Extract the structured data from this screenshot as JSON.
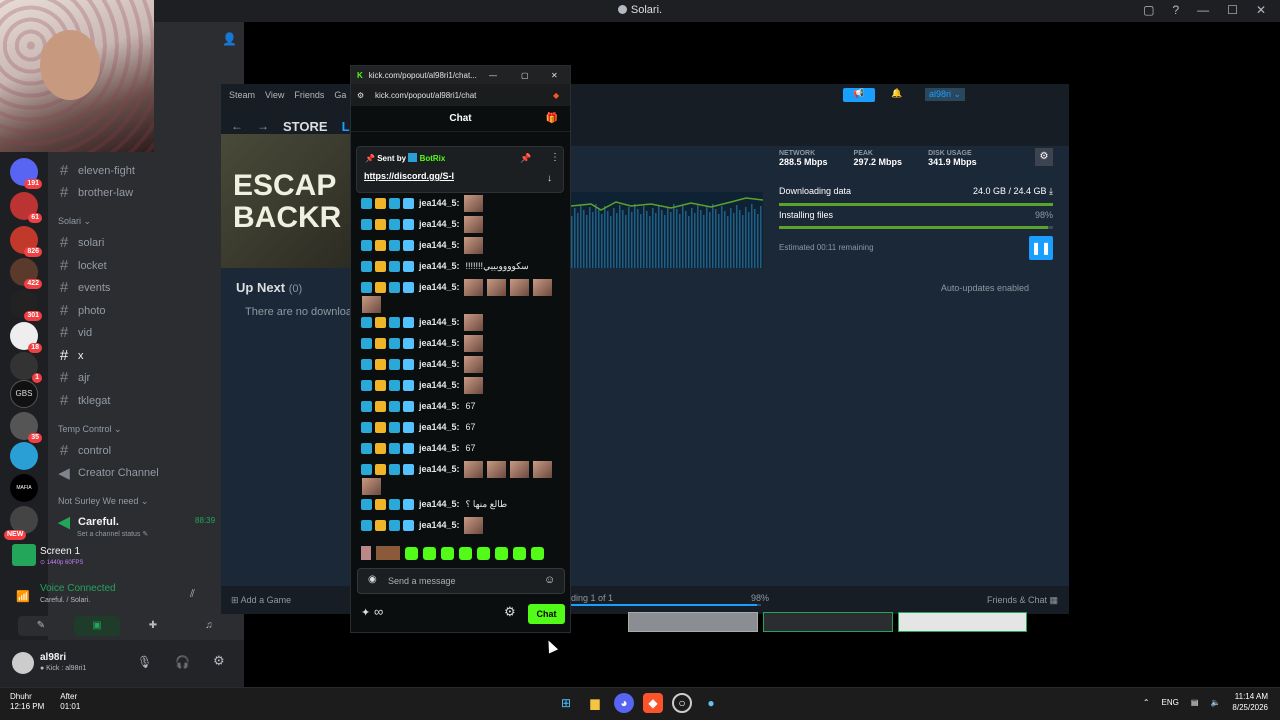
{
  "window": {
    "title": "Solari.",
    "controls": [
      "▢",
      "?",
      "—",
      "☐",
      "✕"
    ]
  },
  "servers": [
    {
      "badge": "191"
    },
    {
      "badge": "61"
    },
    {
      "badge": "826"
    },
    {
      "badge": "422"
    },
    {
      "badge": "301"
    },
    {
      "badge": "18"
    },
    {
      "badge": "1"
    },
    {
      "badge": ""
    },
    {
      "badge": "35"
    },
    {
      "badge": ""
    },
    {
      "badge": ""
    },
    {
      "badge": "NEW"
    }
  ],
  "server_labels": {
    "mafia": "MAFIA",
    "gbs": "GBS"
  },
  "channels": {
    "top": [
      "eleven-fight",
      "brother-law"
    ],
    "solari_category": "Solari ⌄",
    "solari": [
      "solari",
      "locket",
      "events",
      "photo",
      "vid",
      "x",
      "ajr",
      "tklegat"
    ],
    "temp_category": "Temp Control ⌄",
    "temp": [
      "control"
    ],
    "creator": "Creator Channel",
    "notsurely_category": "Not Surley We need ⌄",
    "voice_channel": "Careful.",
    "voice_time": "88:39",
    "channel_status": "Set a channel status ✎"
  },
  "stream": {
    "title": "Screen 1",
    "quality": "⊙ 1440p 60FPS"
  },
  "voice": {
    "status": "Voice Connected",
    "location": "Careful. / Solari."
  },
  "user": {
    "name": "al98ri",
    "sub": "● Kick : al98ri1"
  },
  "steam": {
    "menu": [
      "Steam",
      "View",
      "Friends",
      "Ga"
    ],
    "store": "STORE",
    "library": "LIBRA",
    "banner": "ESCAP\nBACKR",
    "user": "al98ri ⌄",
    "stats": [
      {
        "label": "NETWORK",
        "value": "288.5 Mbps"
      },
      {
        "label": "PEAK",
        "value": "297.2 Mbps"
      },
      {
        "label": "DISK USAGE",
        "value": "341.9 Mbps"
      }
    ],
    "downloading_label": "Downloading data",
    "downloading_value": "24.0 GB / 24.4 GB ⤓",
    "installing_label": "Installing files",
    "installing_value": "98%",
    "installing_progress": 0.98,
    "remaining": "Estimated 00:11 remaining",
    "upnext": "Up Next",
    "upnext_count": "(0)",
    "no_downloads": "There are no downloa",
    "auto_updates": "Auto-updates enabled",
    "add_game": "Add a Game",
    "footer_progress": "ding 1 of 1",
    "footer_pct": "98%",
    "friends_chat": "Friends & Chat"
  },
  "kick": {
    "tab_title": "kick.com/popout/al98ri1/chat...",
    "url": "kick.com/popout/al98ri1/chat",
    "chat_title": "Chat",
    "pinned_sent_by": "Sent by",
    "pinned_user": "BotRix",
    "pinned_link": "https://discord.gg/S-I",
    "messages": [
      {
        "user": "jea144_5:",
        "text": "",
        "emotes": 1
      },
      {
        "user": "jea144_5:",
        "text": "",
        "emotes": 1
      },
      {
        "user": "jea144_5:",
        "text": "",
        "emotes": 1
      },
      {
        "user": "jea144_5:",
        "text": "!!!!!!!سكووووبييي",
        "emotes": 0
      },
      {
        "user": "jea144_5:",
        "text": "",
        "emotes": 4
      },
      {
        "user": "jea144_5:",
        "text": "",
        "emotes": 1
      },
      {
        "user": "jea144_5:",
        "text": "",
        "emotes": 1
      },
      {
        "user": "jea144_5:",
        "text": "",
        "emotes": 1
      },
      {
        "user": "jea144_5:",
        "text": "",
        "emotes": 1
      },
      {
        "user": "jea144_5:",
        "text": "67",
        "emotes": 0
      },
      {
        "user": "jea144_5:",
        "text": "67",
        "emotes": 0
      },
      {
        "user": "jea144_5:",
        "text": "67",
        "emotes": 0
      },
      {
        "user": "jea144_5:",
        "text": "",
        "emotes": 4
      },
      {
        "user": "jea144_5:",
        "text": "طالع منها ؟",
        "emotes": 0
      },
      {
        "user": "jea144_5:",
        "text": "",
        "emotes": 1
      }
    ],
    "input_placeholder": "Send a message",
    "chat_button": "Chat"
  },
  "taskbar": {
    "prayer_name": "Dhuhr",
    "prayer_time": "12:16 PM",
    "after_label": "After",
    "after_time": "01:01",
    "lang": "ENG",
    "time": "11:14 AM",
    "date": "8/25/2026"
  },
  "colors": {
    "kick_green": "#53fc18",
    "steam_blue": "#1a9fff",
    "discord_green": "#23a55a"
  }
}
